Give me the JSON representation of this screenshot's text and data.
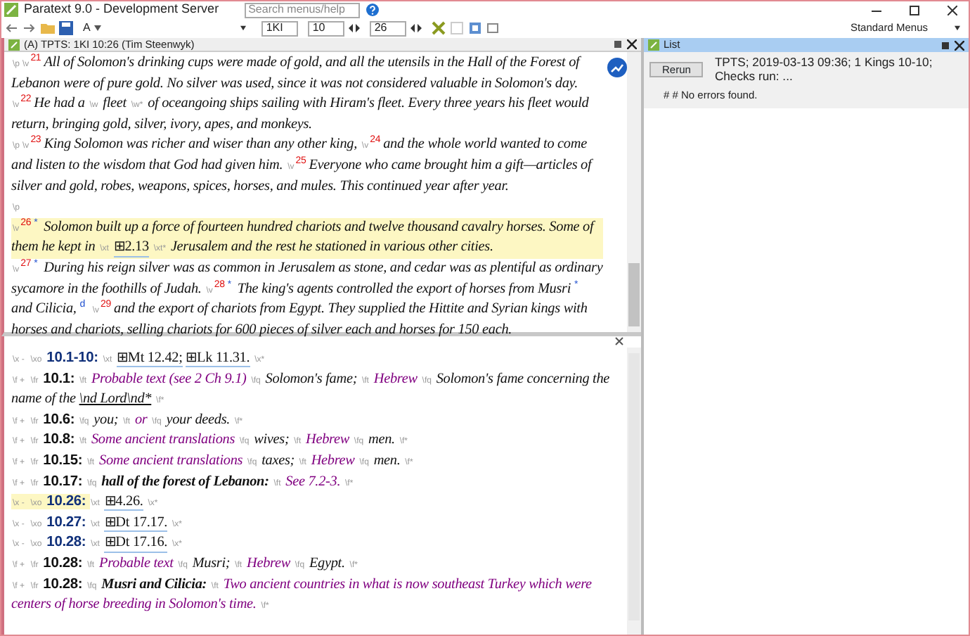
{
  "window": {
    "title": "Paratext 9.0 - Development Server",
    "search": {
      "placeholder": "Search menus/help"
    }
  },
  "toolbar": {
    "font_label": "A",
    "book": "1KI",
    "chapter": "10",
    "verse": "26",
    "menu_mode": "Standard Menus"
  },
  "editor": {
    "title": "(A) TPTS: 1KI 10:26 (Tim Steenwyk)",
    "paragraphs": [
      {
        "marker": "\\p",
        "verses": [
          {
            "marker": "\\v",
            "number": "21",
            "highlighted": false,
            "segments": [
              {
                "kind": "text",
                "text": "All of Solomon's drinking cups were made of gold, and all the utensils in the Hall of the Forest of Lebanon were of pure gold. No silver was used, since it was not considered valuable in Solomon's day."
              }
            ]
          },
          {
            "marker": "\\v",
            "number": "22",
            "highlighted": false,
            "segments": [
              {
                "kind": "text",
                "text": "He had a"
              },
              {
                "kind": "marker",
                "text": "\\w"
              },
              {
                "kind": "text",
                "text": "fleet"
              },
              {
                "kind": "marker",
                "text": "\\w*"
              },
              {
                "kind": "text",
                "text": "of oceangoing ships sailing with Hiram's fleet. Every three years his fleet would return, bringing gold, silver, ivory, apes, and monkeys."
              }
            ]
          }
        ]
      },
      {
        "marker": "\\p",
        "verses": [
          {
            "marker": "\\v",
            "number": "23",
            "highlighted": false,
            "segments": [
              {
                "kind": "text",
                "text": "King Solomon was richer and wiser than any other king,"
              }
            ]
          },
          {
            "marker": "\\v",
            "number": "24",
            "highlighted": false,
            "segments": [
              {
                "kind": "text",
                "text": "and the whole world wanted to come and listen to the wisdom that God had given him."
              }
            ]
          },
          {
            "marker": "\\v",
            "number": "25",
            "highlighted": false,
            "segments": [
              {
                "kind": "text",
                "text": "Everyone who came brought him a gift—articles of silver and gold, robes, weapons, spices, horses, and mules. This continued year after year."
              }
            ]
          }
        ]
      },
      {
        "marker": "\\p",
        "verses": [
          {
            "marker": "\\v",
            "number": "26",
            "highlighted": true,
            "segments": [
              {
                "kind": "caller",
                "text": "*"
              },
              {
                "kind": "text",
                "text": "Solomon built up a force of fourteen hundred chariots and twelve thousand cavalry horses. Some of them he kept in"
              },
              {
                "kind": "marker",
                "text": "\\xt"
              },
              {
                "kind": "xref",
                "text": "⊞2.13"
              },
              {
                "kind": "marker",
                "text": "\\xt*"
              },
              {
                "kind": "text",
                "text": "Jerusalem and the rest he stationed in various other cities."
              }
            ]
          },
          {
            "marker": "\\v",
            "number": "27",
            "highlighted": false,
            "segments": [
              {
                "kind": "caller",
                "text": "*"
              },
              {
                "kind": "text",
                "text": "During his reign silver was as common in Jerusalem as stone, and cedar was as plentiful as ordinary sycamore in the foothills of Judah."
              }
            ]
          },
          {
            "marker": "\\v",
            "number": "28",
            "highlighted": false,
            "segments": [
              {
                "kind": "caller",
                "text": "*"
              },
              {
                "kind": "text",
                "text": "The king's agents controlled the export of horses from Musri"
              },
              {
                "kind": "caller",
                "text": "*"
              },
              {
                "kind": "text",
                "text": "and Cilicia,"
              },
              {
                "kind": "caller",
                "text": "d"
              }
            ]
          },
          {
            "marker": "\\v",
            "number": "29",
            "highlighted": false,
            "segments": [
              {
                "kind": "text",
                "text": "and the export of chariots from Egypt. They supplied the Hittite and Syrian kings with horses and chariots, selling chariots for 600 pieces of silver each and horses for 150 each."
              }
            ]
          }
        ]
      }
    ]
  },
  "notes": {
    "lines": [
      {
        "kind": "crossref",
        "highlighted": false,
        "segments": [
          {
            "kind": "marker",
            "text": "\\x -"
          },
          {
            "kind": "marker",
            "text": "\\xo"
          },
          {
            "kind": "ref",
            "text": "10.1-10:"
          },
          {
            "kind": "marker",
            "text": "\\xt"
          },
          {
            "kind": "xref",
            "text": "⊞Mt 12.42;"
          },
          {
            "kind": "xref",
            "text": "⊞Lk 11.31."
          },
          {
            "kind": "marker",
            "text": "\\x*"
          }
        ]
      },
      {
        "kind": "footnote",
        "highlighted": false,
        "segments": [
          {
            "kind": "marker",
            "text": "\\f +"
          },
          {
            "kind": "marker",
            "text": "\\fr"
          },
          {
            "kind": "ref",
            "text": "10.1:"
          },
          {
            "kind": "marker",
            "text": "\\ft"
          },
          {
            "kind": "ft",
            "text": "Probable text (see 2 Ch 9.1)"
          },
          {
            "kind": "marker",
            "text": "\\fq"
          },
          {
            "kind": "fq",
            "text": "Solomon's fame;"
          },
          {
            "kind": "marker",
            "text": "\\ft"
          },
          {
            "kind": "ft",
            "text": "Hebrew"
          },
          {
            "kind": "marker",
            "text": "\\fq"
          },
          {
            "kind": "fq",
            "text": "Solomon's fame concerning the name of the"
          },
          {
            "kind": "nd",
            "text": "\\nd Lord\\nd*"
          },
          {
            "kind": "marker",
            "text": "\\f*"
          }
        ]
      },
      {
        "kind": "footnote",
        "highlighted": false,
        "segments": [
          {
            "kind": "marker",
            "text": "\\f +"
          },
          {
            "kind": "marker",
            "text": "\\fr"
          },
          {
            "kind": "ref",
            "text": "10.6:"
          },
          {
            "kind": "marker",
            "text": "\\fq"
          },
          {
            "kind": "fq",
            "text": "you;"
          },
          {
            "kind": "marker",
            "text": "\\ft"
          },
          {
            "kind": "ft",
            "text": "or"
          },
          {
            "kind": "marker",
            "text": "\\fq"
          },
          {
            "kind": "fq",
            "text": "your deeds."
          },
          {
            "kind": "marker",
            "text": "\\f*"
          }
        ]
      },
      {
        "kind": "footnote",
        "highlighted": false,
        "segments": [
          {
            "kind": "marker",
            "text": "\\f +"
          },
          {
            "kind": "marker",
            "text": "\\fr"
          },
          {
            "kind": "ref",
            "text": "10.8:"
          },
          {
            "kind": "marker",
            "text": "\\ft"
          },
          {
            "kind": "ft",
            "text": "Some ancient translations"
          },
          {
            "kind": "marker",
            "text": "\\fq"
          },
          {
            "kind": "fq",
            "text": "wives;"
          },
          {
            "kind": "marker",
            "text": "\\ft"
          },
          {
            "kind": "ft",
            "text": "Hebrew"
          },
          {
            "kind": "marker",
            "text": "\\fq"
          },
          {
            "kind": "fq",
            "text": "men."
          },
          {
            "kind": "marker",
            "text": "\\f*"
          }
        ]
      },
      {
        "kind": "footnote",
        "highlighted": false,
        "segments": [
          {
            "kind": "marker",
            "text": "\\f +"
          },
          {
            "kind": "marker",
            "text": "\\fr"
          },
          {
            "kind": "ref",
            "text": "10.15:"
          },
          {
            "kind": "marker",
            "text": "\\ft"
          },
          {
            "kind": "ft",
            "text": "Some ancient translations"
          },
          {
            "kind": "marker",
            "text": "\\fq"
          },
          {
            "kind": "fq",
            "text": "taxes;"
          },
          {
            "kind": "marker",
            "text": "\\ft"
          },
          {
            "kind": "ft",
            "text": "Hebrew"
          },
          {
            "kind": "marker",
            "text": "\\fq"
          },
          {
            "kind": "fq",
            "text": "men."
          },
          {
            "kind": "marker",
            "text": "\\f*"
          }
        ]
      },
      {
        "kind": "footnote",
        "highlighted": false,
        "segments": [
          {
            "kind": "marker",
            "text": "\\f +"
          },
          {
            "kind": "marker",
            "text": "\\fr"
          },
          {
            "kind": "ref",
            "text": "10.17:"
          },
          {
            "kind": "marker",
            "text": "\\fq"
          },
          {
            "kind": "fqa",
            "text": "hall of the forest of Lebanon:"
          },
          {
            "kind": "marker",
            "text": "\\ft"
          },
          {
            "kind": "ft",
            "text": "See 7.2-3."
          },
          {
            "kind": "marker",
            "text": "\\f*"
          }
        ]
      },
      {
        "kind": "crossref",
        "highlighted": true,
        "segments": [
          {
            "kind": "marker",
            "text": "\\x -"
          },
          {
            "kind": "marker",
            "text": "\\xo"
          },
          {
            "kind": "ref",
            "text": "10.26:"
          },
          {
            "kind": "marker",
            "text": "\\xt"
          },
          {
            "kind": "xref",
            "text": "⊞4.26."
          },
          {
            "kind": "marker",
            "text": "\\x*"
          }
        ]
      },
      {
        "kind": "crossref",
        "highlighted": false,
        "segments": [
          {
            "kind": "marker",
            "text": "\\x -"
          },
          {
            "kind": "marker",
            "text": "\\xo"
          },
          {
            "kind": "ref",
            "text": "10.27:"
          },
          {
            "kind": "marker",
            "text": "\\xt"
          },
          {
            "kind": "xref",
            "text": "⊞Dt 17.17."
          },
          {
            "kind": "marker",
            "text": "\\x*"
          }
        ]
      },
      {
        "kind": "crossref",
        "highlighted": false,
        "segments": [
          {
            "kind": "marker",
            "text": "\\x -"
          },
          {
            "kind": "marker",
            "text": "\\xo"
          },
          {
            "kind": "ref",
            "text": "10.28:"
          },
          {
            "kind": "marker",
            "text": "\\xt"
          },
          {
            "kind": "xref",
            "text": "⊞Dt 17.16."
          },
          {
            "kind": "marker",
            "text": "\\x*"
          }
        ]
      },
      {
        "kind": "footnote",
        "highlighted": false,
        "segments": [
          {
            "kind": "marker",
            "text": "\\f +"
          },
          {
            "kind": "marker",
            "text": "\\fr"
          },
          {
            "kind": "ref",
            "text": "10.28:"
          },
          {
            "kind": "marker",
            "text": "\\ft"
          },
          {
            "kind": "ft",
            "text": "Probable text"
          },
          {
            "kind": "marker",
            "text": "\\fq"
          },
          {
            "kind": "fq",
            "text": "Musri;"
          },
          {
            "kind": "marker",
            "text": "\\ft"
          },
          {
            "kind": "ft",
            "text": "Hebrew"
          },
          {
            "kind": "marker",
            "text": "\\fq"
          },
          {
            "kind": "fq",
            "text": "Egypt."
          },
          {
            "kind": "marker",
            "text": "\\f*"
          }
        ]
      },
      {
        "kind": "footnote",
        "highlighted": false,
        "segments": [
          {
            "kind": "marker",
            "text": "\\f +"
          },
          {
            "kind": "marker",
            "text": "\\fr"
          },
          {
            "kind": "ref",
            "text": "10.28:"
          },
          {
            "kind": "marker",
            "text": "\\fq"
          },
          {
            "kind": "fqa",
            "text": "Musri and Cilicia:"
          },
          {
            "kind": "marker",
            "text": "\\ft"
          },
          {
            "kind": "ft",
            "text": "Two ancient countries in what is now southeast Turkey which were centers of horse breeding in Solomon's time."
          },
          {
            "kind": "marker",
            "text": "\\f*"
          }
        ]
      }
    ]
  },
  "list_panel": {
    "title": "List",
    "rerun_button": "Rerun",
    "summary": "TPTS; 2019-03-13 09:36; 1 Kings 10-10; Checks run: ...",
    "result": "# # No errors found."
  }
}
